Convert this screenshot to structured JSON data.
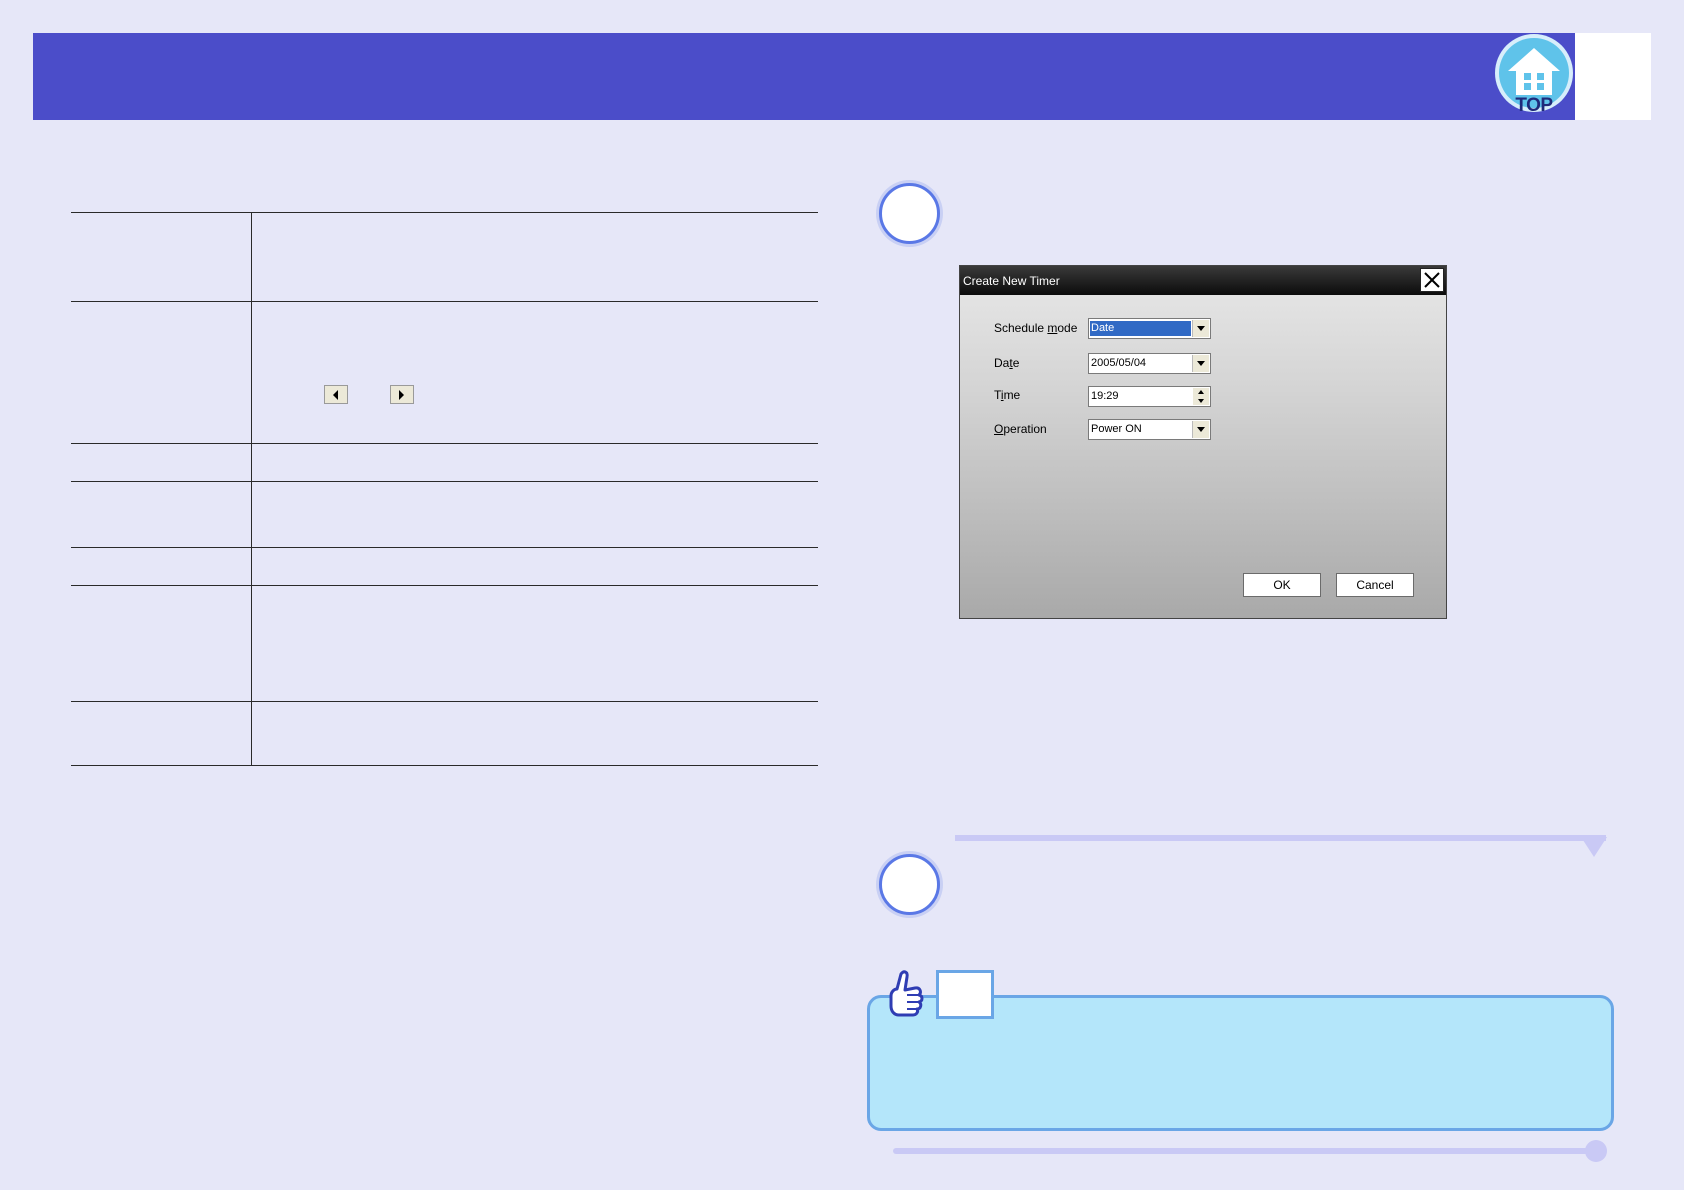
{
  "header": {
    "top_label": "TOP"
  },
  "dialog": {
    "title": "Create New Timer",
    "fields": {
      "schedule_mode": {
        "label_pre": "Schedule ",
        "label_key": "m",
        "label_post": "ode",
        "value": "Date"
      },
      "date": {
        "label_pre": "Da",
        "label_key": "t",
        "label_post": "e",
        "value": "2005/05/04"
      },
      "time": {
        "label_pre": "T",
        "label_key": "i",
        "label_post": "me",
        "value": "19:29"
      },
      "operation": {
        "label_pre": "",
        "label_key": "O",
        "label_post": "peration",
        "value": "Power ON"
      }
    },
    "ok_label": "OK",
    "cancel_label": "Cancel"
  },
  "colors": {
    "background": "#e6e7f8",
    "header": "#4b4dc9",
    "tip_fill": "#b4e6fa",
    "tip_border": "#6aa6e6",
    "accent_line": "#c9c9f5"
  },
  "icons": {
    "top_button": "house-icon",
    "nav_prev": "triangle-left-icon",
    "nav_next": "triangle-right-icon",
    "tip": "pointing-hand-icon",
    "dialog_close": "close-icon"
  }
}
